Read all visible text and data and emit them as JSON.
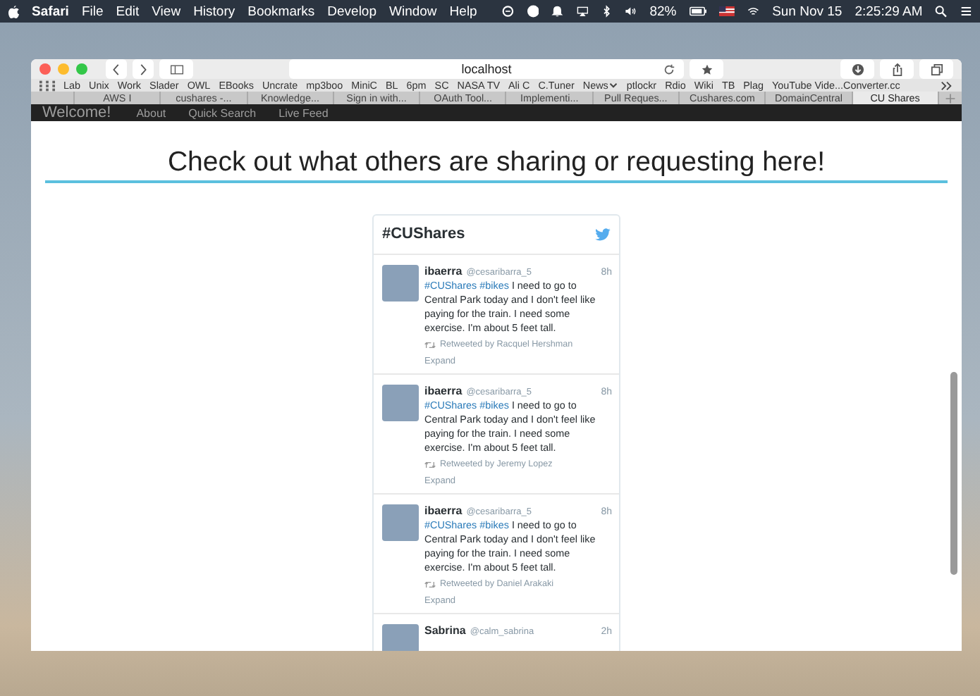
{
  "menu_bar": {
    "app": "Safari",
    "menus": [
      "File",
      "Edit",
      "View",
      "History",
      "Bookmarks",
      "Develop",
      "Window",
      "Help"
    ],
    "battery": "82%",
    "date": "Sun Nov 15",
    "time": "2:25:29 AM"
  },
  "toolbar": {
    "address": "localhost"
  },
  "bookmarks": [
    {
      "label": "Lab",
      "kind": "plain"
    },
    {
      "label": "Unix",
      "kind": "plain"
    },
    {
      "label": "Work",
      "kind": "plain"
    },
    {
      "label": "Slader",
      "kind": "plain"
    },
    {
      "label": "OWL",
      "kind": "plain"
    },
    {
      "label": "EBooks",
      "kind": "plain"
    },
    {
      "label": "Uncrate",
      "kind": "plain"
    },
    {
      "label": "mp3boo",
      "kind": "plain"
    },
    {
      "label": "MiniC",
      "kind": "plain"
    },
    {
      "label": "BL",
      "kind": "plain"
    },
    {
      "label": "6pm",
      "kind": "plain"
    },
    {
      "label": "SC",
      "kind": "plain"
    },
    {
      "label": "NASA TV",
      "kind": "plain"
    },
    {
      "label": "Ali C",
      "kind": "plain"
    },
    {
      "label": "C.Tuner",
      "kind": "plain"
    },
    {
      "label": "News",
      "kind": "folder"
    },
    {
      "label": "ptlockr",
      "kind": "plain"
    },
    {
      "label": "Rdio",
      "kind": "plain"
    },
    {
      "label": "Wiki",
      "kind": "plain"
    },
    {
      "label": "TB",
      "kind": "plain"
    },
    {
      "label": "Plag",
      "kind": "plain"
    },
    {
      "label": "YouTube Vide...Converter.cc",
      "kind": "plain"
    }
  ],
  "tabs": [
    {
      "label": "AWS I",
      "selected": false
    },
    {
      "label": "cushares -...",
      "selected": false
    },
    {
      "label": "Knowledge...",
      "selected": false
    },
    {
      "label": "Sign in with...",
      "selected": false
    },
    {
      "label": "OAuth Tool...",
      "selected": false
    },
    {
      "label": "Implementi...",
      "selected": false
    },
    {
      "label": "Pull Reques...",
      "selected": false
    },
    {
      "label": "Cushares.com",
      "selected": false
    },
    {
      "label": "DomainCentral",
      "selected": false
    },
    {
      "label": "CU Shares",
      "selected": true
    }
  ],
  "navbar": {
    "brand": "Welcome!",
    "links": [
      "About",
      "Quick Search",
      "Live Feed"
    ]
  },
  "heading": "Check out what others are sharing or requesting here!",
  "feed": {
    "title": "#CUShares",
    "tweets": [
      {
        "name": "ibaerra",
        "handle": "@cesaribarra_5",
        "time": "8h",
        "tags": [
          "#CUShares",
          "#bikes"
        ],
        "text": "I need to go to Central Park today and I don't feel like paying for the train. I need some exercise. I'm about 5 feet tall.",
        "retweet": "Retweeted by Racquel Hershman",
        "expand": "Expand"
      },
      {
        "name": "ibaerra",
        "handle": "@cesaribarra_5",
        "time": "8h",
        "tags": [
          "#CUShares",
          "#bikes"
        ],
        "text": "I need to go to Central Park today and I don't feel like paying for the train. I need some exercise. I'm about 5 feet tall.",
        "retweet": "Retweeted by Jeremy Lopez",
        "expand": "Expand"
      },
      {
        "name": "ibaerra",
        "handle": "@cesaribarra_5",
        "time": "8h",
        "tags": [
          "#CUShares",
          "#bikes"
        ],
        "text": "I need to go to Central Park today and I don't feel like paying for the train. I need some exercise. I'm about 5 feet tall.",
        "retweet": "Retweeted by Daniel Arakaki",
        "expand": "Expand"
      },
      {
        "name": "Sabrina",
        "handle": "@calm_sabrina",
        "time": "2h"
      }
    ]
  }
}
